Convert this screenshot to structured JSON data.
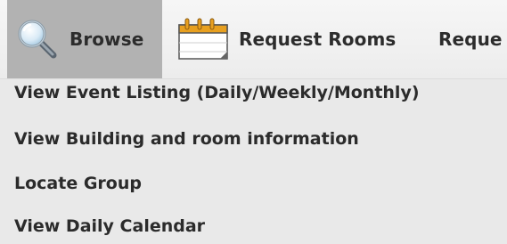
{
  "menubar": {
    "tabs": [
      {
        "label": "Browse",
        "icon": "magnifier-icon",
        "active": true
      },
      {
        "label": "Request Rooms",
        "icon": "calendar-icon",
        "active": false
      },
      {
        "label": "Reque",
        "icon": "",
        "active": false
      }
    ]
  },
  "dropdown": {
    "items": [
      {
        "label": "View Event Listing (Daily/Weekly/Monthly)"
      },
      {
        "label": "View Building and room information"
      },
      {
        "label": "Locate Group"
      },
      {
        "label": "View Daily Calendar"
      }
    ]
  },
  "colors": {
    "active_tab_bg": "#b2b2b2",
    "menubar_bg": "#f1f1f1",
    "dropdown_bg": "#e9e9e9",
    "text": "#2b2b2b",
    "calendar_accent": "#e8a020"
  }
}
